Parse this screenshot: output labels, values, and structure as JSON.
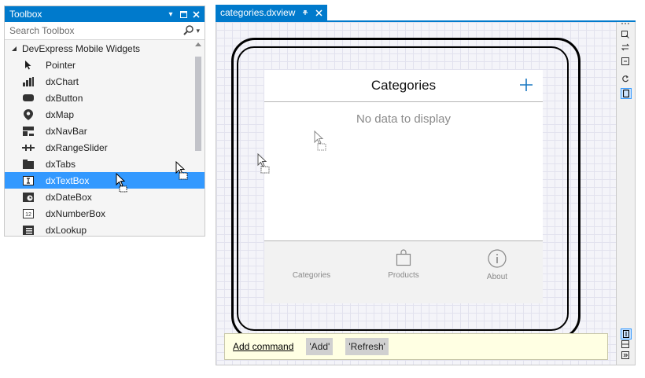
{
  "toolbox": {
    "title": "Toolbox",
    "search_placeholder": "Search Toolbox",
    "group_label": "DevExpress Mobile Widgets",
    "items": [
      {
        "label": "Pointer",
        "icon": "pointer-icon"
      },
      {
        "label": "dxChart",
        "icon": "chart-icon"
      },
      {
        "label": "dxButton",
        "icon": "button-icon"
      },
      {
        "label": "dxMap",
        "icon": "map-pin-icon"
      },
      {
        "label": "dxNavBar",
        "icon": "navbar-icon"
      },
      {
        "label": "dxRangeSlider",
        "icon": "range-slider-icon"
      },
      {
        "label": "dxTabs",
        "icon": "tabs-icon"
      },
      {
        "label": "dxTextBox",
        "icon": "textbox-icon",
        "selected": true
      },
      {
        "label": "dxDateBox",
        "icon": "datebox-icon"
      },
      {
        "label": "dxNumberBox",
        "icon": "numberbox-icon"
      },
      {
        "label": "dxLookup",
        "icon": "lookup-icon"
      }
    ]
  },
  "document": {
    "tab_title": "categories.dxview"
  },
  "app": {
    "title": "Categories",
    "empty_text": "No data to display",
    "tabs": [
      {
        "label": "Categories",
        "icon": "list-icon"
      },
      {
        "label": "Products",
        "icon": "bag-icon"
      },
      {
        "label": "About",
        "icon": "info-icon"
      }
    ]
  },
  "commands": {
    "add_label": "Add command",
    "items": [
      "'Add'",
      "'Refresh'"
    ]
  },
  "colors": {
    "accent": "#007acc",
    "selection": "#3399ff",
    "plus": "#1a78c2",
    "commands_bg": "#ffffe3"
  }
}
